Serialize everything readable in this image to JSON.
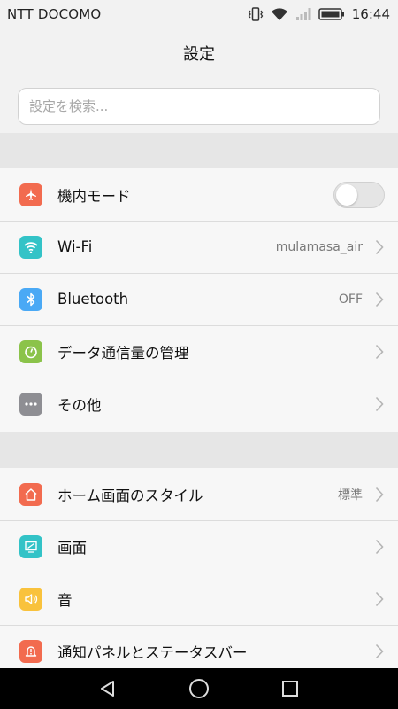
{
  "status_bar": {
    "carrier": "NTT DOCOMO",
    "time": "16:44",
    "icons": [
      "vibrate-icon",
      "wifi-icon",
      "signal-icon",
      "battery-icon"
    ]
  },
  "header": {
    "title": "設定"
  },
  "search": {
    "placeholder": "設定を検索..."
  },
  "groups": [
    {
      "items": [
        {
          "label": "機内モード",
          "icon": "airplane-icon",
          "icon_color": "#f26b4f",
          "control": "toggle",
          "toggle_on": false
        },
        {
          "label": "Wi-Fi",
          "icon": "wifi-icon",
          "icon_color": "#33c3c7",
          "value": "mulamasa_air"
        },
        {
          "label": "Bluetooth",
          "icon": "bluetooth-icon",
          "icon_color": "#4aa9f5",
          "value": "OFF"
        },
        {
          "label": "データ通信量の管理",
          "icon": "data-usage-icon",
          "icon_color": "#8bc34a"
        },
        {
          "label": "その他",
          "icon": "more-icon",
          "icon_color": "#8e8e93"
        }
      ]
    },
    {
      "items": [
        {
          "label": "ホーム画面のスタイル",
          "icon": "home-icon",
          "icon_color": "#f26b4f",
          "value": "標準"
        },
        {
          "label": "画面",
          "icon": "display-icon",
          "icon_color": "#33c3c7"
        },
        {
          "label": "音",
          "icon": "sound-icon",
          "icon_color": "#f9c23c"
        },
        {
          "label": "通知パネルとステータスバー",
          "icon": "notification-icon",
          "icon_color": "#f26b4f"
        }
      ]
    }
  ],
  "nav_bar": {
    "buttons": [
      "back-icon",
      "home-circle-icon",
      "recents-icon"
    ]
  }
}
